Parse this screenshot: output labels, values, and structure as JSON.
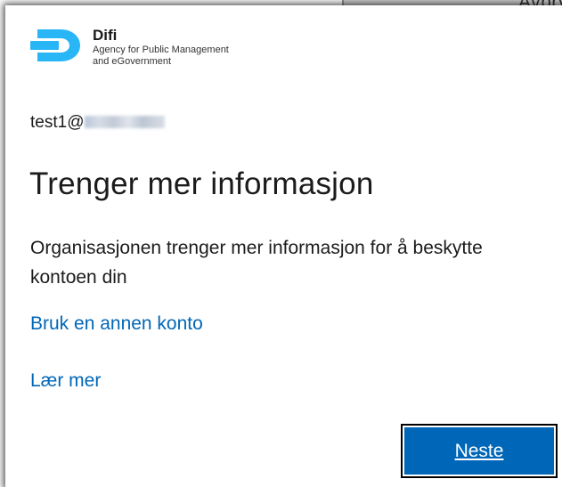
{
  "background_window": {
    "cancel_label": "Avbryt"
  },
  "logo": {
    "title": "Difi",
    "subtitle_line1": "Agency for Public Management",
    "subtitle_line2": "and eGovernment",
    "mark_color": "#29b6f6"
  },
  "account": {
    "email_prefix": "test1@"
  },
  "page": {
    "heading": "Trenger mer informasjon",
    "description": "Organisasjonen trenger mer informasjon for å beskytte kontoen din"
  },
  "links": {
    "use_other_account": "Bruk en annen konto",
    "learn_more": "Lær mer"
  },
  "buttons": {
    "next_label": "Neste"
  },
  "colors": {
    "accent": "#0067b8",
    "text": "#1b1b1b"
  }
}
